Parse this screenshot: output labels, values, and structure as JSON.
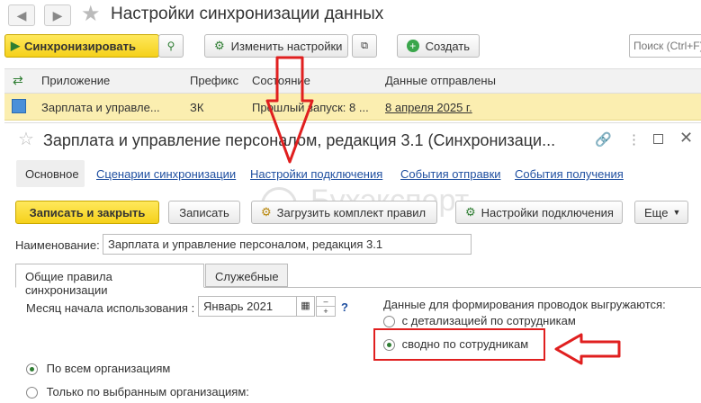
{
  "window": {
    "title": "Настройки синхронизации данных"
  },
  "toolbar": {
    "sync_label": "Синхронизировать",
    "change_settings_label": "Изменить настройки",
    "create_label": "Создать",
    "search_placeholder": "Поиск (Ctrl+F)"
  },
  "table": {
    "headers": [
      "Приложение",
      "Префикс",
      "Состояние",
      "Данные отправлены"
    ],
    "row": {
      "app": "Зарплата и управле...",
      "prefix": "ЗК",
      "state": "Прошлый запуск: 8 ...",
      "sent": "8 апреля 2025 г."
    }
  },
  "form": {
    "title": "Зарплата и управление персоналом, редакция 3.1 (Синхронизаци...",
    "tabs": [
      "Основное",
      "Сценарии синхронизации",
      "Настройки подключения",
      "События отправки",
      "События получения"
    ],
    "buttons": {
      "save_close": "Записать и закрыть",
      "save": "Записать",
      "load_rules": "Загрузить комплект правил",
      "conn_settings": "Настройки подключения",
      "more": "Еще"
    },
    "name_label": "Наименование:",
    "name_value": "Зарплата и управление персоналом, редакция 3.1",
    "inner_tabs": [
      "Общие правила синхронизации",
      "Служебные"
    ],
    "month_label": "Месяц начала использования :",
    "month_value": "Январь 2021",
    "help": "?",
    "export_label": "Данные для формирования проводок выгружаются:",
    "export_options": [
      "с детализацией по сотрудникам",
      "сводно по сотрудникам"
    ],
    "org_options": [
      "По всем организациям",
      "Только по выбранным организациям:"
    ]
  },
  "watermark": "Бухэксперт",
  "colors": {
    "accent_red": "#e01f1f",
    "yellow": "#f5d11b",
    "link": "#1f4fa0"
  }
}
